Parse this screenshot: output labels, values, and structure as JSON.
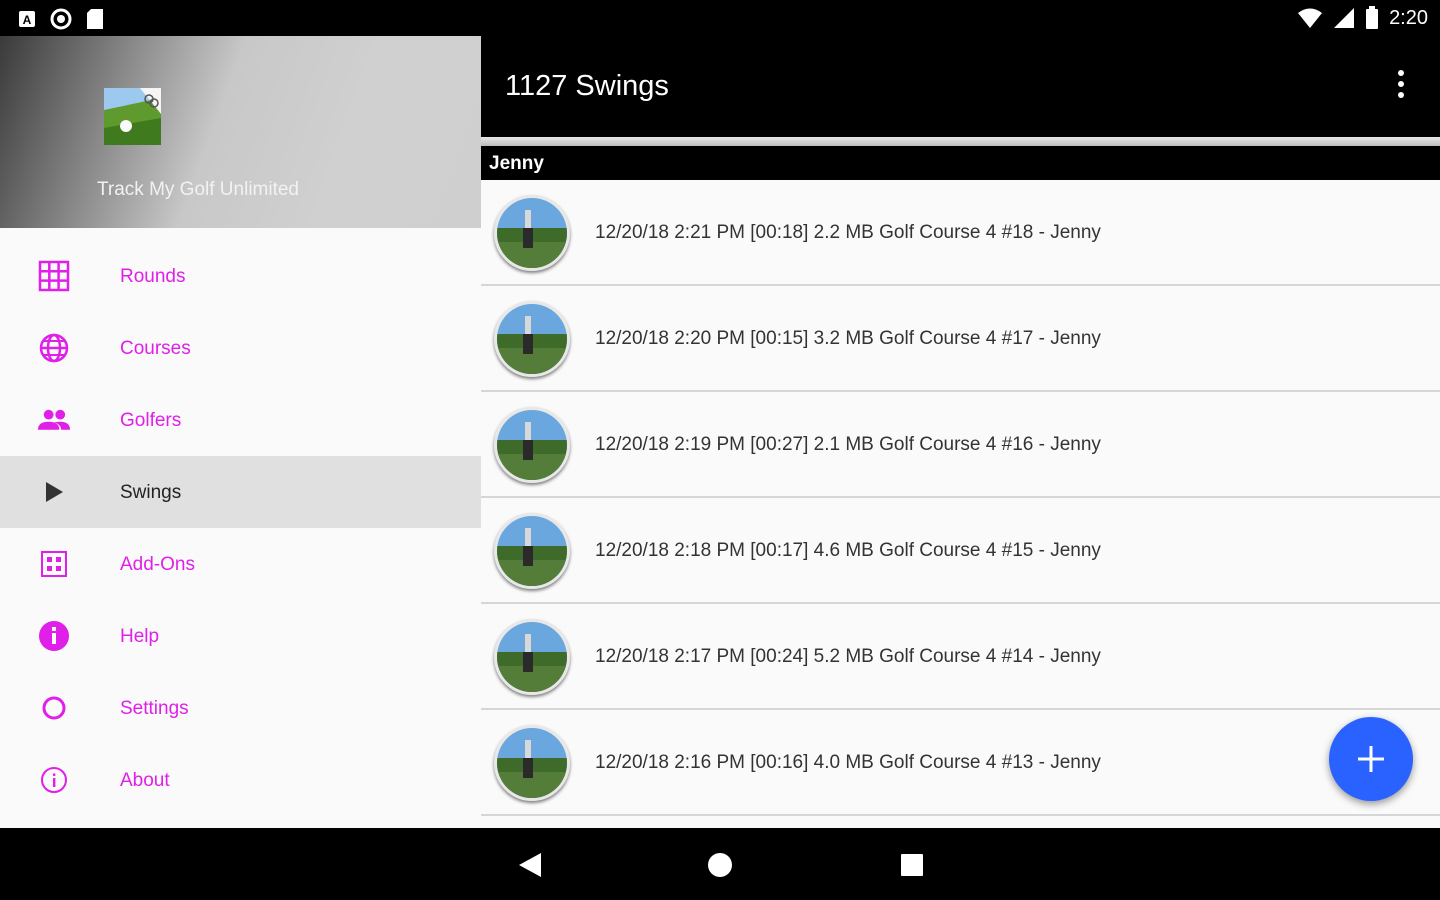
{
  "status_bar": {
    "time": "2:20",
    "left_icons": [
      "a-icon",
      "circle-icon",
      "sd-card-icon"
    ],
    "right_icons": [
      "wifi-icon",
      "signal-icon",
      "battery-icon"
    ]
  },
  "drawer": {
    "app_title": "Track My Golf Unlimited",
    "items": [
      {
        "label": "Rounds",
        "icon": "grid-icon",
        "active": false
      },
      {
        "label": "Courses",
        "icon": "globe-icon",
        "active": false
      },
      {
        "label": "Golfers",
        "icon": "people-icon",
        "active": false
      },
      {
        "label": "Swings",
        "icon": "play-icon",
        "active": true
      },
      {
        "label": "Add-Ons",
        "icon": "apps-icon",
        "active": false
      },
      {
        "label": "Help",
        "icon": "info-filled-icon",
        "active": false
      },
      {
        "label": "Settings",
        "icon": "ring-icon",
        "active": false
      },
      {
        "label": "About",
        "icon": "info-outline-icon",
        "active": false
      }
    ]
  },
  "main": {
    "title": "1127 Swings",
    "group_header": "Jenny",
    "rows": [
      {
        "text": "12/20/18 2:21 PM [00:18] 2.2 MB  Golf Course 4 #18 - Jenny"
      },
      {
        "text": "12/20/18 2:20 PM [00:15] 3.2 MB  Golf Course 4 #17 - Jenny"
      },
      {
        "text": "12/20/18 2:19 PM [00:27] 2.1 MB  Golf Course 4 #16 - Jenny"
      },
      {
        "text": "12/20/18 2:18 PM [00:17] 4.6 MB  Golf Course 4 #15 - Jenny"
      },
      {
        "text": "12/20/18 2:17 PM [00:24] 5.2 MB  Golf Course 4 #14 - Jenny"
      },
      {
        "text": "12/20/18 2:16 PM [00:16] 4.0 MB  Golf Course 4 #13 - Jenny"
      }
    ]
  },
  "colors": {
    "accent": "#e020e8",
    "fab": "#2962ff",
    "appbar": "#000000"
  }
}
